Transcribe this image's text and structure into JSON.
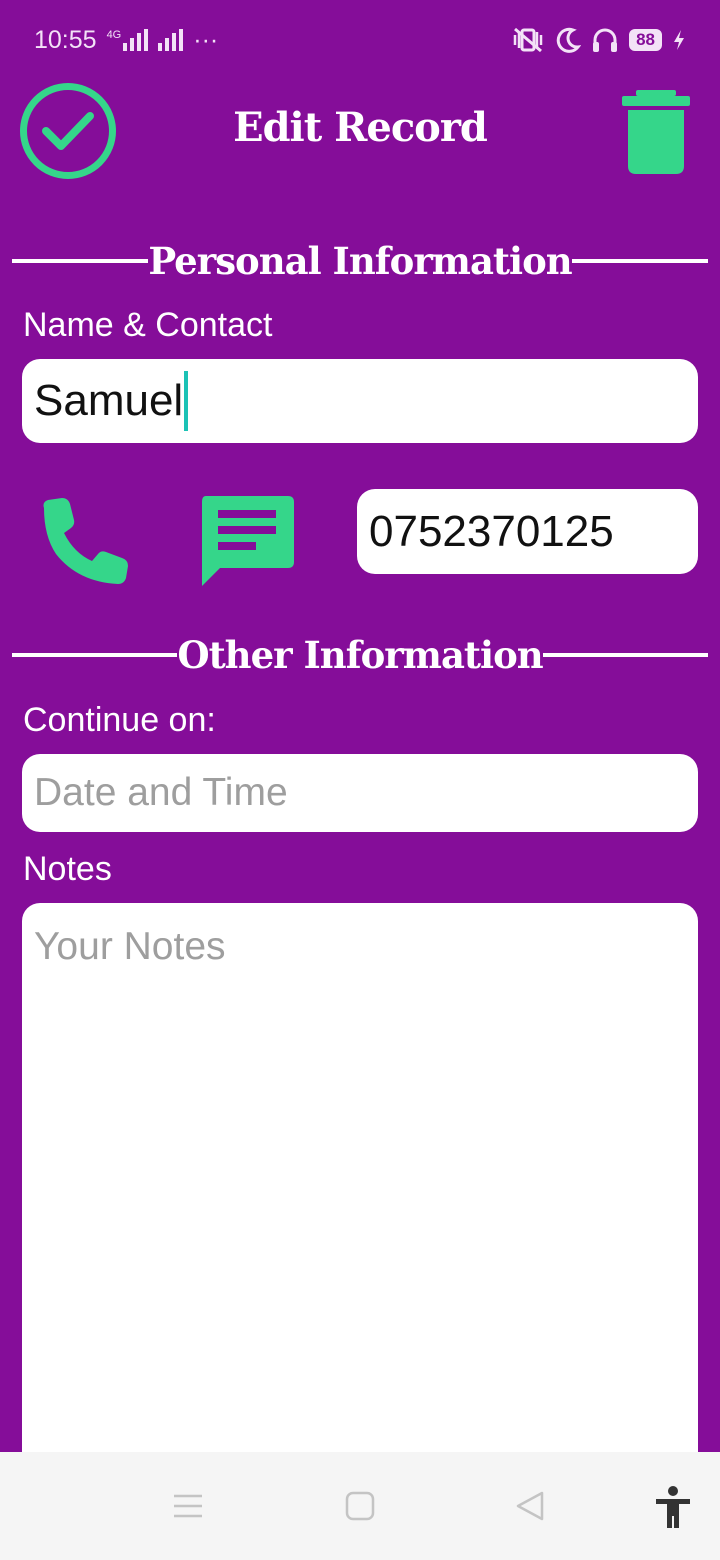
{
  "status_bar": {
    "time": "10:55",
    "network": "4G",
    "more": "···",
    "battery": "88",
    "icons": [
      "signal-icon",
      "signal-icon",
      "mute-vibrate-icon",
      "moon-icon",
      "headphones-icon",
      "battery-icon",
      "charging-icon"
    ]
  },
  "header": {
    "title": "Edit Record",
    "save_icon": "check-circle-icon",
    "delete_icon": "trash-icon"
  },
  "sections": {
    "personal": "Personal Information",
    "other": "Other Information"
  },
  "fields": {
    "name_label": "Name & Contact",
    "name_value": "Samuel",
    "phone_value": "0752370125",
    "continue_label": "Continue on:",
    "continue_placeholder": "Date and Time",
    "notes_label": "Notes",
    "notes_placeholder": "Your Notes"
  },
  "actions": {
    "call_icon": "phone-icon",
    "message_icon": "message-icon"
  },
  "nav": {
    "icons": [
      "menu-icon",
      "home-icon",
      "back-icon",
      "accessibility-icon"
    ]
  },
  "colors": {
    "background": "#850D99",
    "accent": "#35D68A",
    "field": "#FFFFFF"
  }
}
